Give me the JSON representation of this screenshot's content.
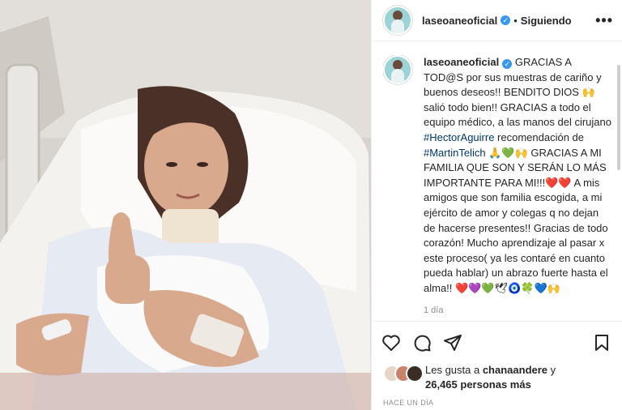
{
  "post": {
    "photo_alt": "",
    "username": "laseoaneoficial",
    "verified_mark": "✓",
    "separator": "•",
    "follow_status": "Siguiendo",
    "more_icon": "more-horizontal-icon"
  },
  "caption": {
    "username": "laseoaneoficial",
    "text_1": " GRACIAS A TOD@S por sus muestras de cariño y buenos deseos!! BENDITO DIOS 🙌 salió todo bien!! GRACIAS a todo el equipo médico, a las manos del cirujano ",
    "tag_1": "#HectorAguirre",
    "text_2": " recomendación de ",
    "tag_2": "#MartinTelich",
    "text_3": " 🙏💚🙌 GRACIAS A MI FAMILIA QUE SON Y SERÁN LO MÁS IMPORTANTE PARA MI!!!❤️❤️ A mis amigos que son familia escogida, a mi ejército de amor y colegas q no dejan de hacerse presentes!! Gracias de todo corazón! Mucho aprendizaje al pasar x este proceso( ya les contaré en cuanto pueda hablar) un abrazo fuerte hasta el alma!! ❤️💜💚🕊🧿🍀💙🙌",
    "age": "1 día"
  },
  "actions": {
    "like_icon": "heart-icon",
    "comment_icon": "comment-icon",
    "share_icon": "paper-plane-icon",
    "save_icon": "bookmark-icon"
  },
  "likes": {
    "prefix": "Les gusta a ",
    "user": "chanaandere",
    "middle": " y ",
    "count": "26,465 personas más"
  },
  "date": "HACE UN DÍA",
  "colors": {
    "accent": "#3897f0",
    "text": "#262626",
    "muted": "#8e8e8e",
    "heart": "#ed4956"
  }
}
